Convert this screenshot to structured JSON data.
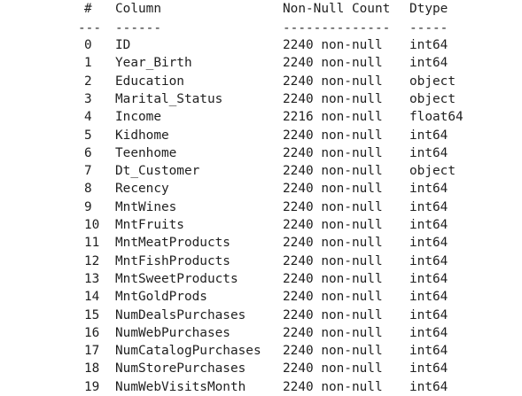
{
  "header": {
    "index": "#",
    "column": "Column",
    "non_null_count": "Non-Null Count",
    "dtype": "Dtype"
  },
  "separator": {
    "index": "---",
    "column": "------",
    "non_null_count": "--------------",
    "dtype": "-----"
  },
  "rows": [
    {
      "index": "0",
      "column": "ID",
      "non_null": "2240 non-null",
      "dtype": "int64"
    },
    {
      "index": "1",
      "column": "Year_Birth",
      "non_null": "2240 non-null",
      "dtype": "int64"
    },
    {
      "index": "2",
      "column": "Education",
      "non_null": "2240 non-null",
      "dtype": "object"
    },
    {
      "index": "3",
      "column": "Marital_Status",
      "non_null": "2240 non-null",
      "dtype": "object"
    },
    {
      "index": "4",
      "column": "Income",
      "non_null": "2216 non-null",
      "dtype": "float64"
    },
    {
      "index": "5",
      "column": "Kidhome",
      "non_null": "2240 non-null",
      "dtype": "int64"
    },
    {
      "index": "6",
      "column": "Teenhome",
      "non_null": "2240 non-null",
      "dtype": "int64"
    },
    {
      "index": "7",
      "column": "Dt_Customer",
      "non_null": "2240 non-null",
      "dtype": "object"
    },
    {
      "index": "8",
      "column": "Recency",
      "non_null": "2240 non-null",
      "dtype": "int64"
    },
    {
      "index": "9",
      "column": "MntWines",
      "non_null": "2240 non-null",
      "dtype": "int64"
    },
    {
      "index": "10",
      "column": "MntFruits",
      "non_null": "2240 non-null",
      "dtype": "int64"
    },
    {
      "index": "11",
      "column": "MntMeatProducts",
      "non_null": "2240 non-null",
      "dtype": "int64"
    },
    {
      "index": "12",
      "column": "MntFishProducts",
      "non_null": "2240 non-null",
      "dtype": "int64"
    },
    {
      "index": "13",
      "column": "MntSweetProducts",
      "non_null": "2240 non-null",
      "dtype": "int64"
    },
    {
      "index": "14",
      "column": "MntGoldProds",
      "non_null": "2240 non-null",
      "dtype": "int64"
    },
    {
      "index": "15",
      "column": "NumDealsPurchases",
      "non_null": "2240 non-null",
      "dtype": "int64"
    },
    {
      "index": "16",
      "column": "NumWebPurchases",
      "non_null": "2240 non-null",
      "dtype": "int64"
    },
    {
      "index": "17",
      "column": "NumCatalogPurchases",
      "non_null": "2240 non-null",
      "dtype": "int64"
    },
    {
      "index": "18",
      "column": "NumStorePurchases",
      "non_null": "2240 non-null",
      "dtype": "int64"
    },
    {
      "index": "19",
      "column": "NumWebVisitsMonth",
      "non_null": "2240 non-null",
      "dtype": "int64"
    }
  ]
}
